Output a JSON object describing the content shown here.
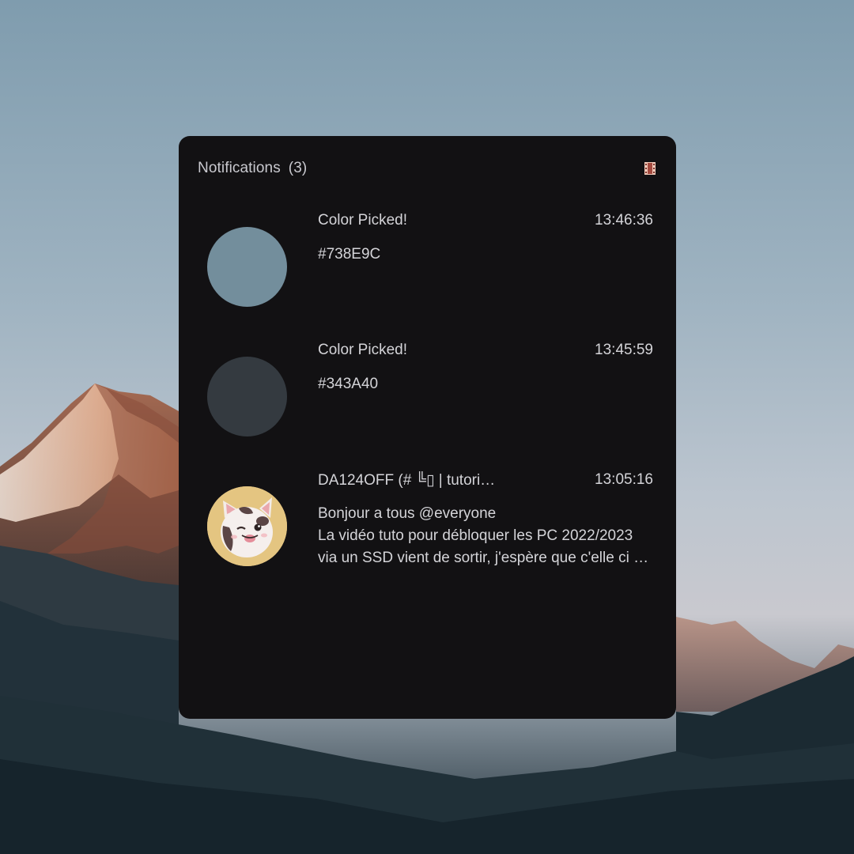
{
  "header": {
    "title": "Notifications",
    "count": "(3)",
    "dnd_icon": "film-strip-icon"
  },
  "notifications": [
    {
      "summary": "Color Picked!",
      "time": "13:46:36",
      "body": [
        "#738E9C"
      ],
      "icon": "color-swatch-icon",
      "swatch_color": "#738E9C"
    },
    {
      "summary": "Color Picked!",
      "time": "13:45:59",
      "body": [
        "#343A40"
      ],
      "icon": "color-swatch-icon",
      "swatch_color": "#343A40"
    },
    {
      "summary": "DA124OFF (# ╚▯ | tutori…",
      "time": "13:05:16",
      "body": [
        "Bonjour a tous @everyone",
        "La vidéo tuto pour débloquer les PC 2022/2023",
        "via un SSD vient de sortir, j'espère que c'elle ci …"
      ],
      "icon": "cat-avatar-icon"
    }
  ],
  "colors": {
    "panel_bg": "#121113",
    "text": "#d4d4d8",
    "title_text": "#c9c9cf"
  }
}
